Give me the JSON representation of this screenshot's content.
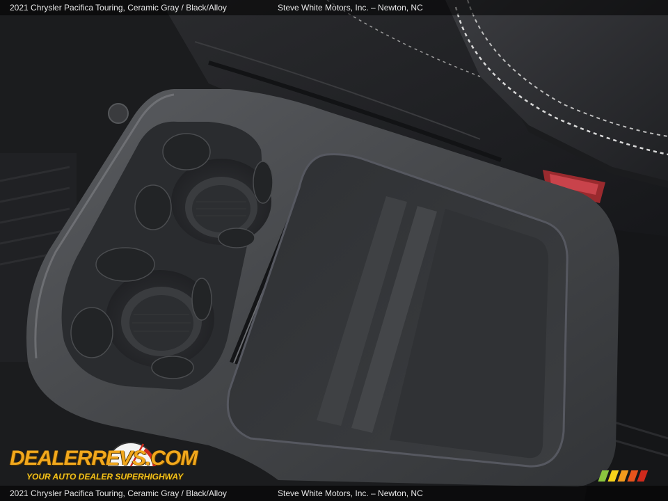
{
  "caption": {
    "vehicle": "2021 Chrysler Pacifica Touring,  Ceramic Gray / Black/Alloy",
    "dealer": "Steve White Motors, Inc. – Newton, NC"
  },
  "watermark": {
    "wordmark": "DEALERREVS.COM",
    "tagline": "YOUR AUTO DEALER SUPERHIGHWAY"
  },
  "colors": {
    "plastic": "#46484b",
    "upholstery": "#232427",
    "stitching": "#d9d9d9",
    "logo_orange": "#f2a81d",
    "stripe_colors": [
      "#8cc63f",
      "#f7d31b",
      "#f29a1d",
      "#e8541c",
      "#d02a1c"
    ]
  }
}
